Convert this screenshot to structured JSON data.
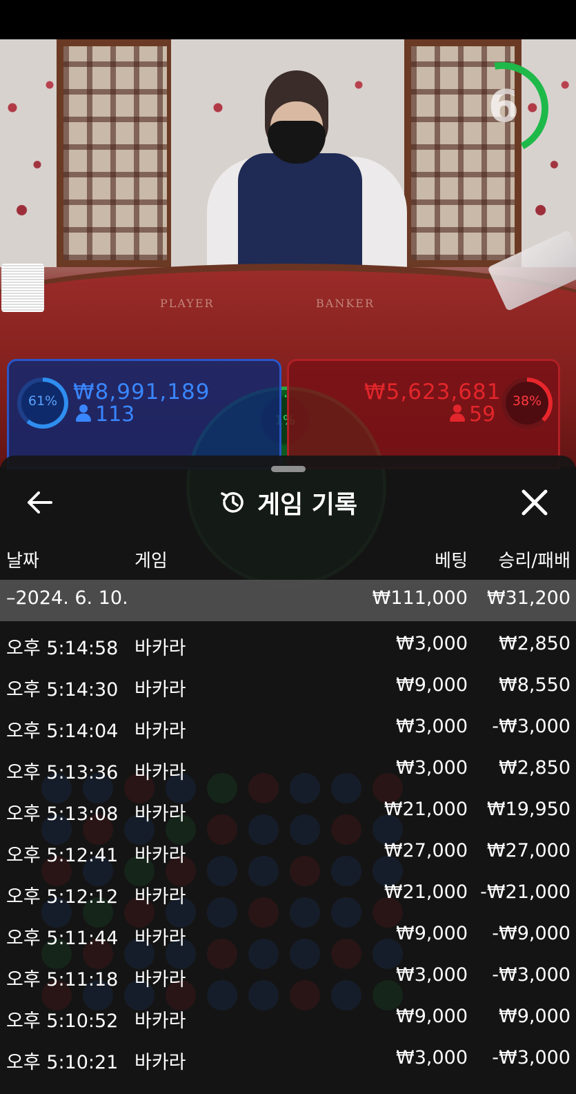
{
  "stream": {
    "countdown": "6",
    "countdown_fraction": 0.45,
    "table_labels": {
      "player": "PLAYER",
      "banker": "BANKER"
    }
  },
  "bets": {
    "player": {
      "percent": "61%",
      "percent_value": 0.61,
      "amount": "₩8,991,189",
      "players": "113",
      "color": "#2f72e6"
    },
    "banker": {
      "percent": "38%",
      "percent_value": 0.38,
      "amount": "₩5,623,681",
      "players": "59",
      "color": "#e2262b"
    },
    "tie": {
      "percent": "1%",
      "percent_value": 0.01,
      "color": "#2aa84a"
    }
  },
  "history": {
    "title": "게임 기록",
    "columns": {
      "date": "날짜",
      "game": "게임",
      "bet": "베팅",
      "result": "승리/패배"
    },
    "date_group": {
      "label": "–2024. 6. 10.",
      "total_bet": "₩111,000",
      "total_result": "₩31,200"
    },
    "rows": [
      {
        "time": "오후 5:14:58",
        "game": "바카라",
        "bet": "₩3,000",
        "result": "₩2,850"
      },
      {
        "time": "오후 5:14:30",
        "game": "바카라",
        "bet": "₩9,000",
        "result": "₩8,550"
      },
      {
        "time": "오후 5:14:04",
        "game": "바카라",
        "bet": "₩3,000",
        "result": "-₩3,000"
      },
      {
        "time": "오후 5:13:36",
        "game": "바카라",
        "bet": "₩3,000",
        "result": "₩2,850"
      },
      {
        "time": "오후 5:13:08",
        "game": "바카라",
        "bet": "₩21,000",
        "result": "₩19,950"
      },
      {
        "time": "오후 5:12:41",
        "game": "바카라",
        "bet": "₩27,000",
        "result": "₩27,000"
      },
      {
        "time": "오후 5:12:12",
        "game": "바카라",
        "bet": "₩21,000",
        "result": "-₩21,000"
      },
      {
        "time": "오후 5:11:44",
        "game": "바카라",
        "bet": "₩9,000",
        "result": "-₩9,000"
      },
      {
        "time": "오후 5:11:18",
        "game": "바카라",
        "bet": "₩3,000",
        "result": "-₩3,000"
      },
      {
        "time": "오후 5:10:52",
        "game": "바카라",
        "bet": "₩9,000",
        "result": "₩9,000"
      },
      {
        "time": "오후 5:10:21",
        "game": "바카라",
        "bet": "₩3,000",
        "result": "-₩3,000"
      }
    ]
  },
  "icons": {
    "back": "arrow-left-icon",
    "history": "history-icon",
    "close": "close-icon",
    "person": "person-icon"
  }
}
